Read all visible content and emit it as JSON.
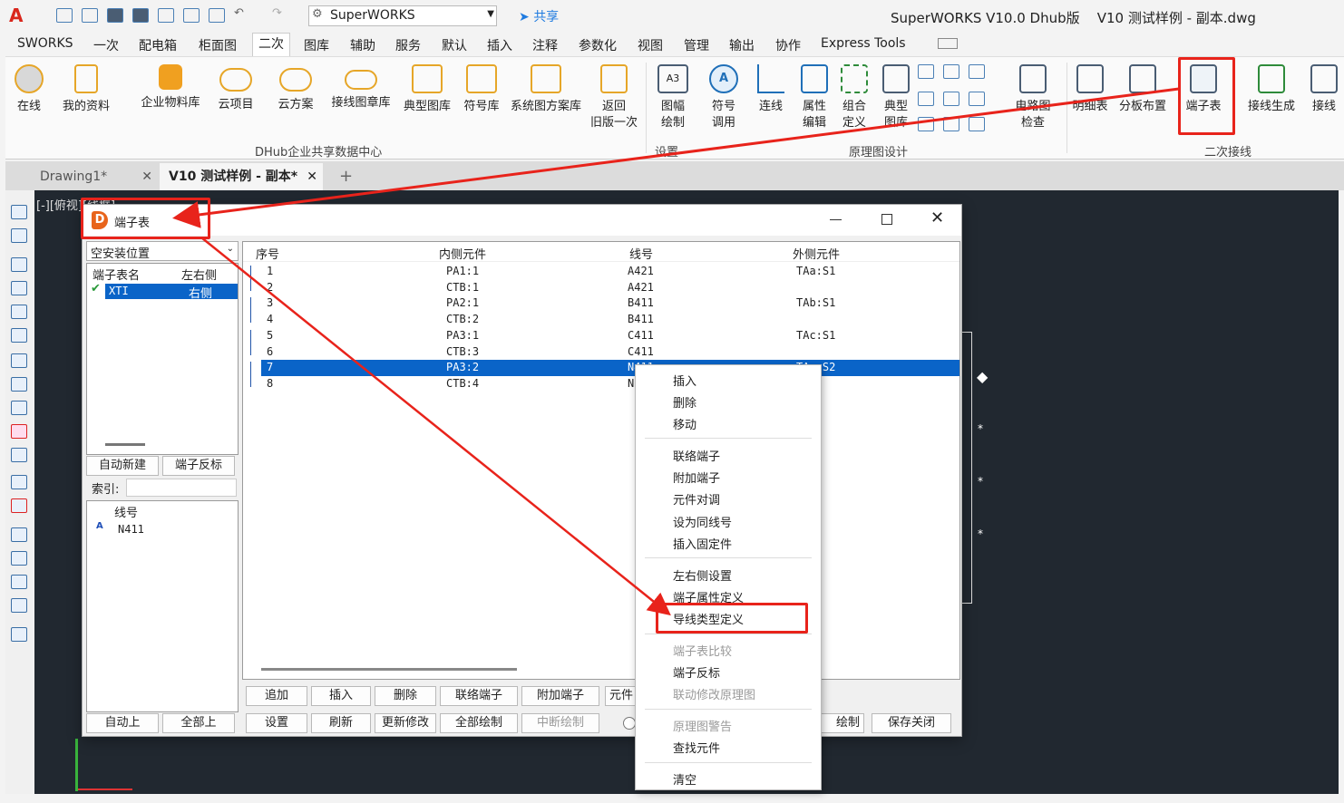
{
  "app": {
    "workspace": "SuperWORKS",
    "share": "共享",
    "title": "SuperWORKS V10.0 Dhub版    V10 测试样例 - 副本.dwg"
  },
  "menu": [
    "SWORKS",
    "一次",
    "配电箱",
    "柜面图",
    "二次",
    "图库",
    "辅助",
    "服务",
    "默认",
    "插入",
    "注释",
    "参数化",
    "视图",
    "管理",
    "输出",
    "协作",
    "Express Tools"
  ],
  "ribbon": {
    "items": [
      {
        "label": "在线"
      },
      {
        "label": "我的资料"
      },
      {
        "label": "企业物料库"
      },
      {
        "label": "云项目"
      },
      {
        "label": "云方案"
      },
      {
        "label": "接线图章库"
      },
      {
        "label": "典型图库"
      },
      {
        "label": "符号库"
      },
      {
        "label": "系统图方案库"
      },
      {
        "label": "返回",
        "label2": "旧版一次"
      },
      {
        "label": "图幅",
        "label2": "绘制"
      },
      {
        "label": "符号",
        "label2": "调用"
      },
      {
        "label": "连线"
      },
      {
        "label": "属性",
        "label2": "编辑"
      },
      {
        "label": "组合",
        "label2": "定义"
      },
      {
        "label": "典型",
        "label2": "图库"
      },
      {
        "label": "电路图",
        "label2": "检查"
      },
      {
        "label": "明细表"
      },
      {
        "label": "分板布置"
      },
      {
        "label": "端子表"
      },
      {
        "label": "接线生成"
      },
      {
        "label": "接线"
      }
    ],
    "groups": [
      "DHub企业共享数据中心",
      "设置",
      "原理图设计",
      "二次接线"
    ]
  },
  "doc_tabs": [
    "Drawing1*",
    "V10 测试样例 - 副本*"
  ],
  "viewport_label": "[-][俯视][线框]",
  "dialog": {
    "title": "端子表",
    "location_select": "空安装位置",
    "strip_headers": [
      "端子表名",
      "左右侧"
    ],
    "strip_rows": [
      {
        "name": "XTI",
        "side": "右侧"
      }
    ],
    "btn_auto_new": "自动新建",
    "btn_reverse": "端子反标",
    "index_label": "索引:",
    "wire_header": "线号",
    "wire_items": [
      "N411"
    ],
    "table_headers": [
      "序号",
      "内侧元件",
      "线号",
      "外侧元件"
    ],
    "table_rows": [
      {
        "no": "1",
        "inner": "PA1:1",
        "wire": "A421",
        "outer": "TAa:S1"
      },
      {
        "no": "2",
        "inner": "CTB:1",
        "wire": "A421",
        "outer": ""
      },
      {
        "no": "3",
        "inner": "PA2:1",
        "wire": "B411",
        "outer": "TAb:S1"
      },
      {
        "no": "4",
        "inner": "CTB:2",
        "wire": "B411",
        "outer": ""
      },
      {
        "no": "5",
        "inner": "PA3:1",
        "wire": "C411",
        "outer": "TAc:S1"
      },
      {
        "no": "6",
        "inner": "CTB:3",
        "wire": "C411",
        "outer": ""
      },
      {
        "no": "7",
        "inner": "PA3:2",
        "wire": "N411",
        "outer": "TAn:S2"
      },
      {
        "no": "8",
        "inner": "CTB:4",
        "wire": "N",
        "outer": ""
      }
    ],
    "bottom_row1": [
      "追加",
      "插入",
      "删除",
      "联络端子",
      "附加端子",
      "元件"
    ],
    "bottom_row2": [
      "设置",
      "刷新",
      "更新修改",
      "全部绘制",
      "中断绘制",
      "绘制",
      "保存关闭"
    ],
    "left_bottom": [
      "自动上",
      "全部上"
    ]
  },
  "context_menu": {
    "groups": [
      [
        "插入",
        "删除",
        "移动"
      ],
      [
        "联络端子",
        "附加端子",
        "元件对调",
        "设为同线号",
        "插入固定件"
      ],
      [
        "左右侧设置",
        "端子属性定义",
        "导线类型定义"
      ],
      [
        "端子表比较",
        "端子反标",
        "联动修改原理图"
      ],
      [
        "原理图警告",
        "查找元件"
      ],
      [
        "清空"
      ]
    ],
    "disabled": [
      "端子表比较",
      "联动修改原理图",
      "原理图警告"
    ]
  },
  "colors": {
    "accent": "#0078d7",
    "selection": "#0a64c8",
    "highlight": "#e8231b"
  }
}
